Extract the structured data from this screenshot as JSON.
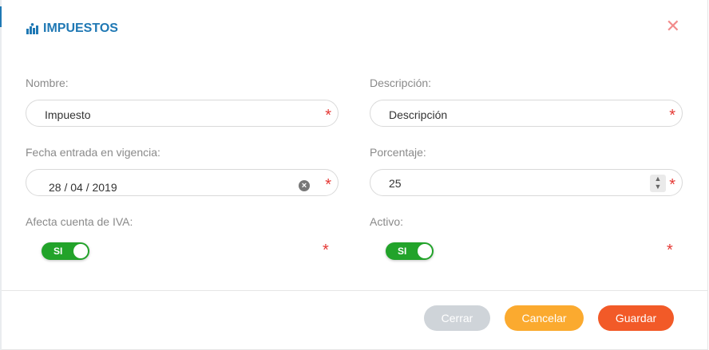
{
  "modal": {
    "title": "IMPUESTOS",
    "title_icon": "bar-chart-icon",
    "close_glyph": "✕"
  },
  "form": {
    "nombre": {
      "label": "Nombre:",
      "value": "Impuesto"
    },
    "descripcion": {
      "label": "Descripción:",
      "value": "Descripción"
    },
    "fecha": {
      "label": "Fecha entrada en vigencia:",
      "value": "28 / 04 / 2019"
    },
    "porcentaje": {
      "label": "Porcentaje:",
      "value": "25"
    },
    "afecta_iva": {
      "label": "Afecta cuenta de IVA:",
      "toggle": "SI"
    },
    "activo": {
      "label": "Activo:",
      "toggle": "SI"
    },
    "required_mark": "*"
  },
  "footer": {
    "close_label": "Cerrar",
    "cancel_label": "Cancelar",
    "save_label": "Guardar"
  },
  "colors": {
    "accent": "#1f78b4",
    "toggle_on": "#22a32a",
    "cancel": "#fbaa2f",
    "save": "#f25a28",
    "disabled": "#cfd4d9",
    "required": "#e53935"
  }
}
